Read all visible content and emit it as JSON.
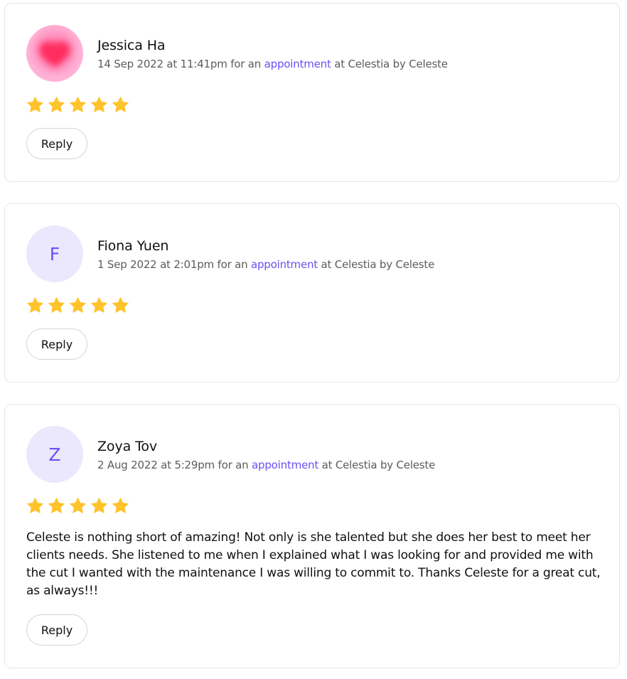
{
  "reviews": [
    {
      "name": "Jessica Ha",
      "avatar": {
        "type": "image",
        "icon": "heart-icon",
        "initial": ""
      },
      "date": "14 Sep 2022 at 11:41pm",
      "for_text": " for an ",
      "link_text": "appointment",
      "at_text": " at Celestia by Celeste",
      "rating": 5,
      "text": "",
      "reply_label": "Reply"
    },
    {
      "name": "Fiona Yuen",
      "avatar": {
        "type": "initial",
        "icon": "",
        "initial": "F"
      },
      "date": "1 Sep 2022 at 2:01pm",
      "for_text": " for an ",
      "link_text": "appointment",
      "at_text": " at Celestia by Celeste",
      "rating": 5,
      "text": "",
      "reply_label": "Reply"
    },
    {
      "name": "Zoya Tov",
      "avatar": {
        "type": "initial",
        "icon": "",
        "initial": "Z"
      },
      "date": "2 Aug 2022 at 5:29pm",
      "for_text": " for an ",
      "link_text": "appointment",
      "at_text": " at Celestia by Celeste",
      "rating": 5,
      "text": "Celeste is nothing short of amazing! Not only is she talented but she does her best to meet her clients needs. She listened to me when I explained what I was looking for and provided me with the cut I wanted with the maintenance I was willing to commit to. Thanks Celeste for a great cut, as always!!!",
      "reply_label": "Reply"
    }
  ],
  "colors": {
    "accent": "#6950f3",
    "star": "#ffc32b",
    "avatar_bg": "#ebe8fd",
    "border": "#e5e5e5"
  },
  "icons": {
    "star": "star-icon"
  }
}
